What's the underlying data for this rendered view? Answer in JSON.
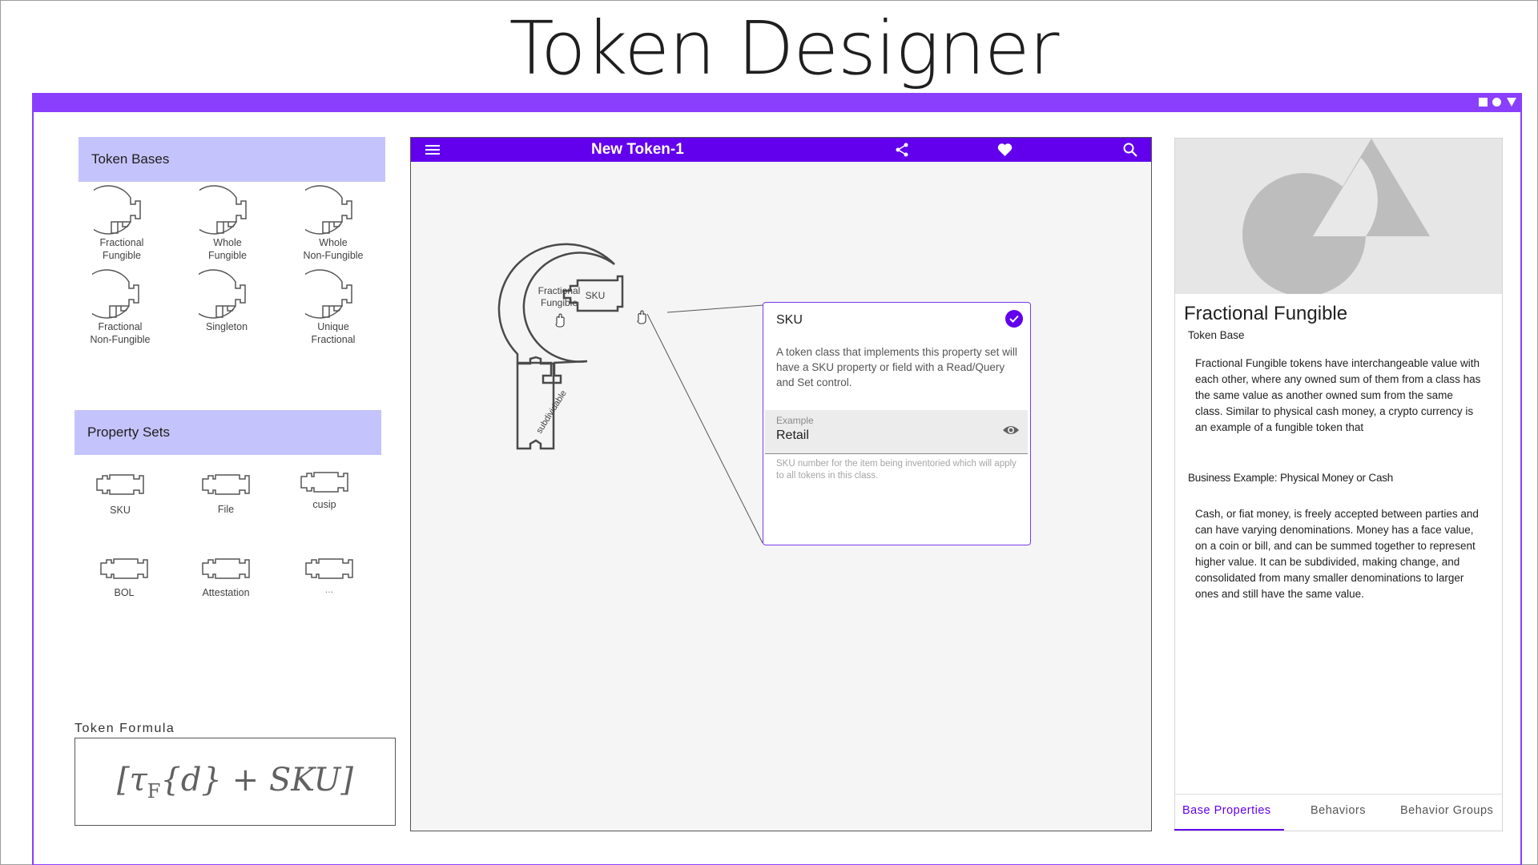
{
  "page": {
    "title": "Token Designer"
  },
  "token_bases": {
    "header": "Token Bases",
    "items": [
      {
        "label": "Fractional\nFungible",
        "icon": "round-puzzle-piece-icon"
      },
      {
        "label": "Whole\nFungible",
        "icon": "round-puzzle-piece-icon"
      },
      {
        "label": "Whole\nNon-Fungible",
        "icon": "round-puzzle-piece-icon"
      },
      {
        "label": "Fractional\nNon-Fungible",
        "icon": "round-puzzle-piece-icon"
      },
      {
        "label": "Singleton",
        "icon": "round-puzzle-piece-icon"
      },
      {
        "label": "Unique\nFractional",
        "icon": "round-puzzle-piece-icon"
      }
    ]
  },
  "property_sets": {
    "header": "Property Sets",
    "items": [
      {
        "label": "SKU",
        "icon": "puzzle-connector-icon"
      },
      {
        "label": "File",
        "icon": "puzzle-connector-icon"
      },
      {
        "label": "cusip",
        "icon": "puzzle-connector-icon"
      },
      {
        "label": "BOL",
        "icon": "puzzle-connector-icon"
      },
      {
        "label": "Attestation",
        "icon": "puzzle-connector-icon"
      },
      {
        "label": "...",
        "icon": "puzzle-connector-icon"
      }
    ]
  },
  "formula": {
    "label": "Token Formula",
    "expression": "[τF{d} + SKU]"
  },
  "canvas": {
    "title": "New Token-1",
    "icons": [
      "menu-icon",
      "share-icon",
      "heart-icon",
      "search-icon"
    ],
    "assembly": {
      "base_label": "Fractional Fungible",
      "property_label": "SKU",
      "behavior_label": "subdividable"
    }
  },
  "sku_card": {
    "title": "SKU",
    "description": "A token class that implements this property set will have a SKU property or field with a Read/Query and Set control.",
    "field_label": "Example",
    "field_value": "Retail",
    "help_text": "SKU number for the item being inventoried which will apply to all tokens in this class."
  },
  "details": {
    "title": "Fractional Fungible",
    "subtitle": "Token Base",
    "description": "Fractional Fungible tokens have interchangeable value with each other, where any owned sum of them from a class has the same value as another owned sum from the same class. Similar to physical cash money, a crypto currency is an example of a fungible token that",
    "business_label": "Business Example: Physical Money or Cash",
    "business_text": "Cash, or fiat money, is freely accepted between parties and can have varying denominations. Money has a face value, on a coin or bill, and can be summed together to represent higher value.  It can be subdivided, making change, and consolidated from many smaller denominations to larger ones and still have the same value."
  },
  "tabs": [
    {
      "label": "Base Properties",
      "active": true
    },
    {
      "label": "Behaviors",
      "active": false
    },
    {
      "label": "Behavior Groups",
      "active": false
    }
  ],
  "colors": {
    "accent": "#6200ee",
    "window_bar": "#8a3ffc",
    "panel_header": "#c5c3fb"
  }
}
